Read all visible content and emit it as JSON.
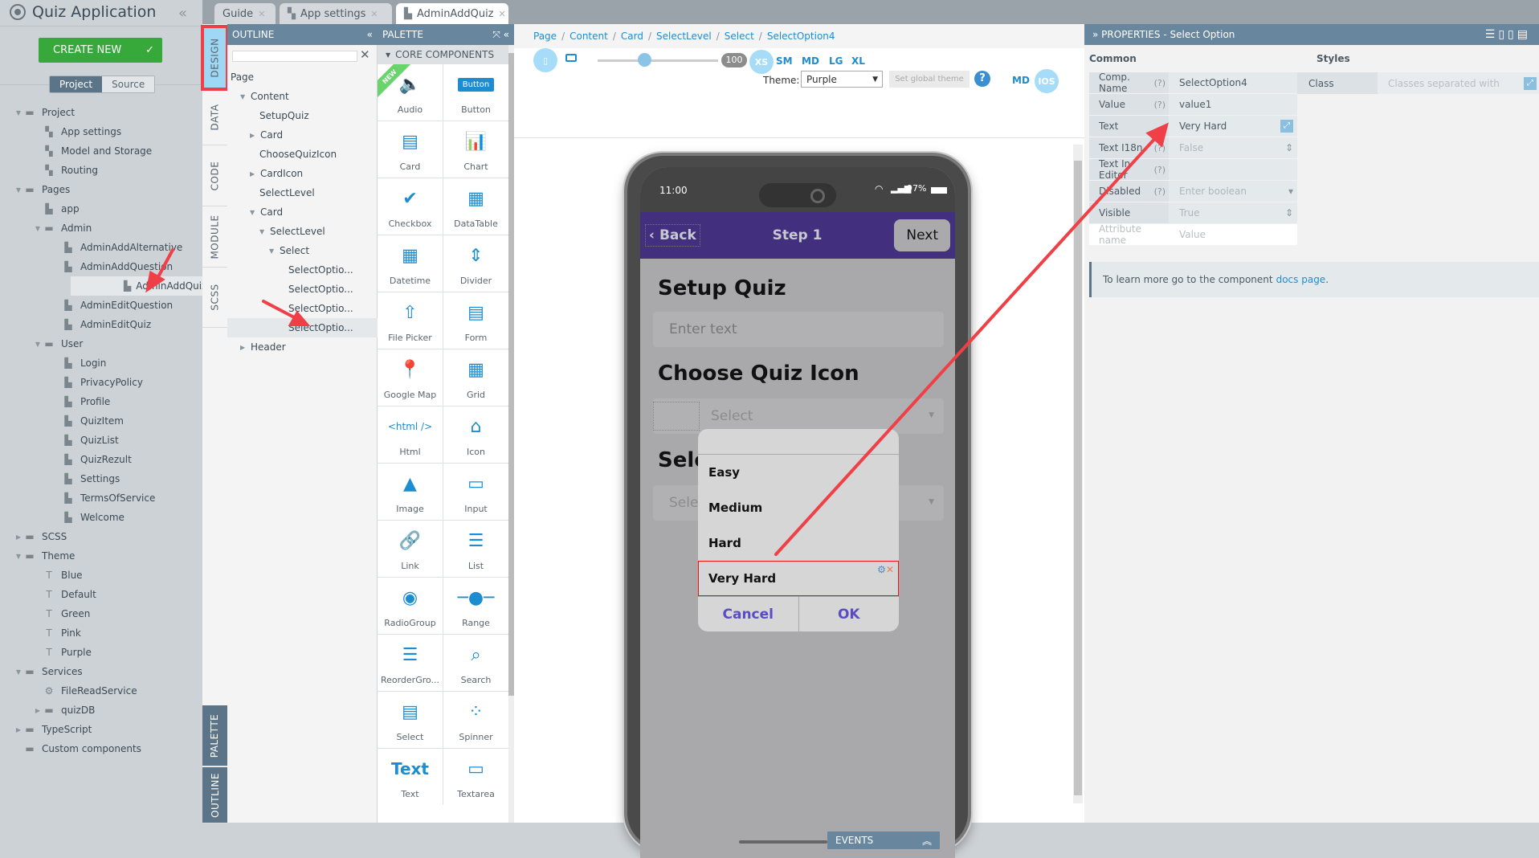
{
  "app": {
    "title": "Quiz Application",
    "collapse_icon": "«"
  },
  "left": {
    "create_new": "CREATE NEW",
    "toggle": {
      "project": "Project",
      "source": "Source"
    },
    "tree": [
      {
        "label": "Project",
        "level": 0,
        "arrow": "down",
        "icon": "folder"
      },
      {
        "label": "App settings",
        "level": 1,
        "icon": "settings-doc"
      },
      {
        "label": "Model and Storage",
        "level": 1,
        "icon": "settings-doc"
      },
      {
        "label": "Routing",
        "level": 1,
        "icon": "settings-doc"
      },
      {
        "label": "Pages",
        "level": 0,
        "arrow": "down",
        "icon": "folder"
      },
      {
        "label": "app",
        "level": 1,
        "icon": "page"
      },
      {
        "label": "Admin",
        "level": 1,
        "arrow": "down",
        "icon": "folder"
      },
      {
        "label": "AdminAddAlternative",
        "level": 2,
        "icon": "file"
      },
      {
        "label": "AdminAddQuestion",
        "level": 2,
        "icon": "file"
      },
      {
        "label": "AdminAddQuiz",
        "level": 2,
        "icon": "file",
        "selected": true
      },
      {
        "label": "AdminEditQuestion",
        "level": 2,
        "icon": "file"
      },
      {
        "label": "AdminEditQuiz",
        "level": 2,
        "icon": "file"
      },
      {
        "label": "User",
        "level": 1,
        "arrow": "down",
        "icon": "folder"
      },
      {
        "label": "Login",
        "level": 2,
        "icon": "file"
      },
      {
        "label": "PrivacyPolicy",
        "level": 2,
        "icon": "file"
      },
      {
        "label": "Profile",
        "level": 2,
        "icon": "file"
      },
      {
        "label": "QuizItem",
        "level": 2,
        "icon": "file"
      },
      {
        "label": "QuizList",
        "level": 2,
        "icon": "file"
      },
      {
        "label": "QuizRezult",
        "level": 2,
        "icon": "file"
      },
      {
        "label": "Settings",
        "level": 2,
        "icon": "file"
      },
      {
        "label": "TermsOfService",
        "level": 2,
        "icon": "file"
      },
      {
        "label": "Welcome",
        "level": 2,
        "icon": "file"
      },
      {
        "label": "SCSS",
        "level": 0,
        "arrow": "right",
        "icon": "folder"
      },
      {
        "label": "Theme",
        "level": 0,
        "arrow": "down",
        "icon": "folder"
      },
      {
        "label": "Blue",
        "level": 1,
        "icon": "theme"
      },
      {
        "label": "Default",
        "level": 1,
        "icon": "theme"
      },
      {
        "label": "Green",
        "level": 1,
        "icon": "theme"
      },
      {
        "label": "Pink",
        "level": 1,
        "icon": "theme"
      },
      {
        "label": "Purple",
        "level": 1,
        "icon": "theme"
      },
      {
        "label": "Services",
        "level": 0,
        "arrow": "down",
        "icon": "folder"
      },
      {
        "label": "FileReadService",
        "level": 1,
        "icon": "gear"
      },
      {
        "label": "quizDB",
        "level": 1,
        "arrow": "right",
        "icon": "folder"
      },
      {
        "label": "TypeScript",
        "level": 0,
        "arrow": "right",
        "icon": "folder"
      },
      {
        "label": "Custom components",
        "level": 0,
        "icon": "folder"
      }
    ]
  },
  "vtabs": {
    "design": "DESIGN",
    "data": "DATA",
    "code": "CODE",
    "module": "MODULE",
    "scss": "SCSS",
    "palette": "PALETTE",
    "outline": "OUTLINE"
  },
  "tabs": [
    {
      "label": "Guide",
      "icon": ""
    },
    {
      "label": "App settings",
      "icon": "settings-doc"
    },
    {
      "label": "AdminAddQuiz",
      "icon": "page",
      "active": true
    }
  ],
  "outline": {
    "title": "OUTLINE",
    "tree": [
      {
        "label": "Page",
        "indent": 0
      },
      {
        "label": "Content",
        "indent": 1,
        "arrow": "down"
      },
      {
        "label": "SetupQuiz",
        "indent": 3
      },
      {
        "label": "Card",
        "indent": 2,
        "arrow": "right"
      },
      {
        "label": "ChooseQuizIcon",
        "indent": 3
      },
      {
        "label": "CardIcon",
        "indent": 2,
        "arrow": "right"
      },
      {
        "label": "SelectLevel",
        "indent": 3
      },
      {
        "label": "Card",
        "indent": 2,
        "arrow": "down"
      },
      {
        "label": "SelectLevel",
        "indent": 3,
        "arrow": "down"
      },
      {
        "label": "Select",
        "indent": 4,
        "arrow": "down"
      },
      {
        "label": "SelectOptio...",
        "indent": 6
      },
      {
        "label": "SelectOptio...",
        "indent": 6
      },
      {
        "label": "SelectOptio...",
        "indent": 6
      },
      {
        "label": "SelectOptio...",
        "indent": 6,
        "selected": true
      },
      {
        "label": "Header",
        "indent": 1,
        "arrow": "right"
      }
    ]
  },
  "palette": {
    "title": "PALETTE",
    "section": "CORE COMPONENTS",
    "new_badge": "NEW",
    "items": [
      "Audio",
      "Button",
      "Card",
      "Chart",
      "Checkbox",
      "DataTable",
      "Datetime",
      "Divider",
      "File Picker",
      "Form",
      "Google Map",
      "Grid",
      "Html",
      "Icon",
      "Image",
      "Input",
      "Link",
      "List",
      "RadioGroup",
      "Range",
      "ReorderGro...",
      "Search",
      "Select",
      "Spinner",
      "Text",
      "Textarea"
    ],
    "icon_texts": {
      "button": "Button",
      "html": "<html />",
      "text": "Text"
    }
  },
  "canvas": {
    "breadcrumb": [
      "Page",
      "Content",
      "Card",
      "SelectLevel",
      "Select",
      "SelectOption4"
    ],
    "zoom": "100",
    "zoom_slider_fraction": 0.33,
    "breakpoints": [
      "XS",
      "SM",
      "MD",
      "LG",
      "XL"
    ],
    "active_breakpoint": "XS",
    "theme_label": "Theme:",
    "theme_value": "Purple",
    "set_global_theme": "Set global theme",
    "platforms": [
      "MD",
      "IOS"
    ],
    "active_platform": "IOS",
    "events": "EVENTS"
  },
  "phone": {
    "time": "11:00",
    "battery": "97%",
    "back": "Back",
    "title": "Step 1",
    "next": "Next",
    "setup_heading": "Setup Quiz",
    "setup_placeholder": "Enter text",
    "icon_heading": "Choose Quiz Icon",
    "icon_select": "Select",
    "level_heading": "Sele",
    "level_select": "Selec",
    "dialog": {
      "options": [
        "Easy",
        "Medium",
        "Hard",
        "Very Hard"
      ],
      "selected": "Very Hard",
      "cancel": "Cancel",
      "ok": "OK"
    }
  },
  "properties": {
    "title": "PROPERTIES - Select Option",
    "common": "Common",
    "styles": "Styles",
    "rows": [
      {
        "key": "Comp. Name",
        "help": "(?)",
        "value": "SelectOption4"
      },
      {
        "key": "Value",
        "help": "(?)",
        "value": "value1"
      },
      {
        "key": "Text",
        "help": "",
        "value": "Very Hard"
      },
      {
        "key": "Text I18n",
        "help": "(?)",
        "value": "False",
        "muted": true
      },
      {
        "key": "Text In Editor",
        "help": "(?)",
        "value": ""
      },
      {
        "key": "Disabled",
        "help": "(?)",
        "value": "Enter boolean",
        "muted": true
      },
      {
        "key": "Visible",
        "help": "",
        "value": "True",
        "muted": true
      }
    ],
    "attr_placeholder_name": "Attribute name",
    "attr_placeholder_value": "Value",
    "class_label": "Class",
    "class_placeholder": "Classes separated with",
    "docs_text": "To learn more go to the component",
    "docs_link": "docs page",
    "docs_suffix": "."
  },
  "colors": {
    "accent": "#1d8dcf",
    "panel_header": "#68869e",
    "create_green": "#37a93b",
    "phone_header": "#42307f",
    "annotation_red": "#ef4047"
  }
}
